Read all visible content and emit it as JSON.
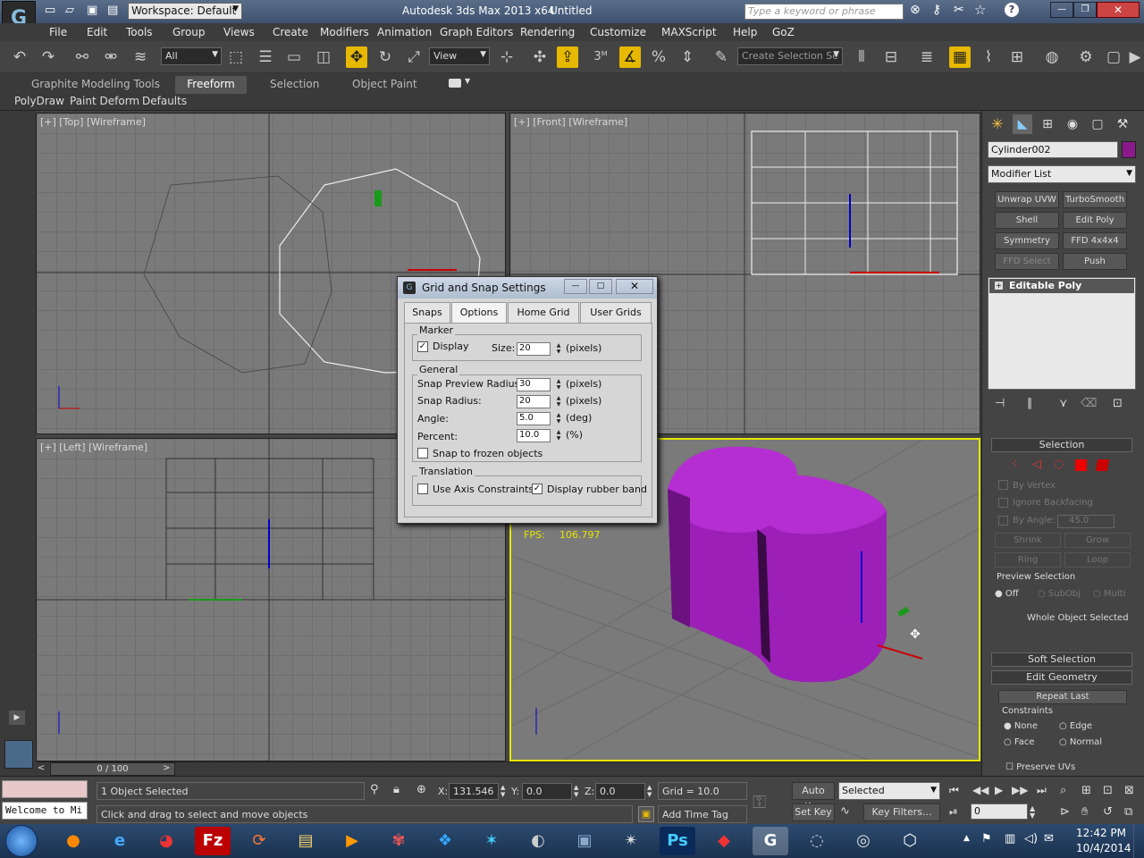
{
  "titlebar": {
    "workspace": "Workspace: Default",
    "app_title": "Autodesk 3ds Max  2013 x64",
    "doc_title": "Untitled",
    "search_placeholder": "Type a keyword or phrase"
  },
  "menu": [
    "File",
    "Edit",
    "Tools",
    "Group",
    "Views",
    "Create",
    "Modifiers",
    "Animation",
    "Graph Editors",
    "Rendering",
    "Customize",
    "MAXScript",
    "Help",
    "GoZ"
  ],
  "toolbar": {
    "filter": "All",
    "ref_coord": "View",
    "selection_set_placeholder": "Create Selection Se",
    "snap_number": "3"
  },
  "ribbon": {
    "tabs": [
      "Graphite Modeling Tools",
      "Freeform",
      "Selection",
      "Object Paint"
    ],
    "subtabs": [
      "PolyDraw",
      "Paint Deform",
      "Defaults"
    ]
  },
  "viewports": {
    "top": "[+] [Top] [Wireframe]",
    "front": "[+] [Front] [Wireframe]",
    "left": "[+] [Left] [Wireframe]",
    "persp_fps_label": "FPS:",
    "persp_fps_value": "106.797"
  },
  "dialog": {
    "title": "Grid and Snap Settings",
    "tabs": [
      "Snaps",
      "Options",
      "Home Grid",
      "User Grids"
    ],
    "marker": {
      "label": "Marker",
      "display_label": "Display",
      "display_checked": true,
      "size_label": "Size:",
      "size_value": "20",
      "size_unit": "(pixels)"
    },
    "general": {
      "label": "General",
      "preview_radius_label": "Snap Preview Radius:",
      "preview_radius_value": "30",
      "preview_radius_unit": "(pixels)",
      "snap_radius_label": "Snap Radius:",
      "snap_radius_value": "20",
      "snap_radius_unit": "(pixels)",
      "angle_label": "Angle:",
      "angle_value": "5.0",
      "angle_unit": "(deg)",
      "percent_label": "Percent:",
      "percent_value": "10.0",
      "percent_unit": "(%)",
      "frozen_label": "Snap to frozen objects"
    },
    "translation": {
      "label": "Translation",
      "axis_label": "Use Axis Constraints",
      "rubber_label": "Display rubber band",
      "rubber_checked": true
    }
  },
  "cmd": {
    "object_name": "Cylinder002",
    "object_color": "#8a1a8a",
    "modifier_list": "Modifier List",
    "mod_buttons": [
      "Unwrap UVW",
      "TurboSmooth",
      "Shell",
      "Edit Poly",
      "Symmetry",
      "FFD 4x4x4",
      "FFD Select",
      "Push"
    ],
    "stack_item": "Editable Poly",
    "selection_head": "Selection",
    "by_vertex": "By Vertex",
    "ignore_backfacing": "Ignore Backfacing",
    "by_angle": "By Angle:",
    "by_angle_value": "45.0",
    "shrink": "Shrink",
    "grow": "Grow",
    "ring": "Ring",
    "loop": "Loop",
    "preview_selection": "Preview Selection",
    "off": "Off",
    "subobj": "SubObj",
    "multi": "Multi",
    "whole_object": "Whole Object Selected",
    "soft_selection": "Soft Selection",
    "edit_geometry": "Edit Geometry",
    "repeat_last": "Repeat Last",
    "constraints": "Constraints",
    "none": "None",
    "edge": "Edge",
    "face": "Face",
    "normal": "Normal",
    "preserve_uvs": "Preserve UVs"
  },
  "timeline": {
    "frame": "0 / 100"
  },
  "status": {
    "maxscript": "Welcome to Mi",
    "selected": "1 Object Selected",
    "prompt": "Click and drag to select and move objects",
    "x_label": "X:",
    "x_value": "131.546",
    "y_label": "Y:",
    "y_value": "0.0",
    "z_label": "Z:",
    "z_value": "0.0",
    "grid": "Grid = 10.0",
    "add_time_tag": "Add Time Tag",
    "auto_key": "Auto Key",
    "selected_combo": "Selected",
    "set_key": "Set Key",
    "key_filters": "Key Filters...",
    "frame_field": "0"
  },
  "taskbar": {
    "time": "12:42 PM",
    "date": "10/4/2014"
  }
}
